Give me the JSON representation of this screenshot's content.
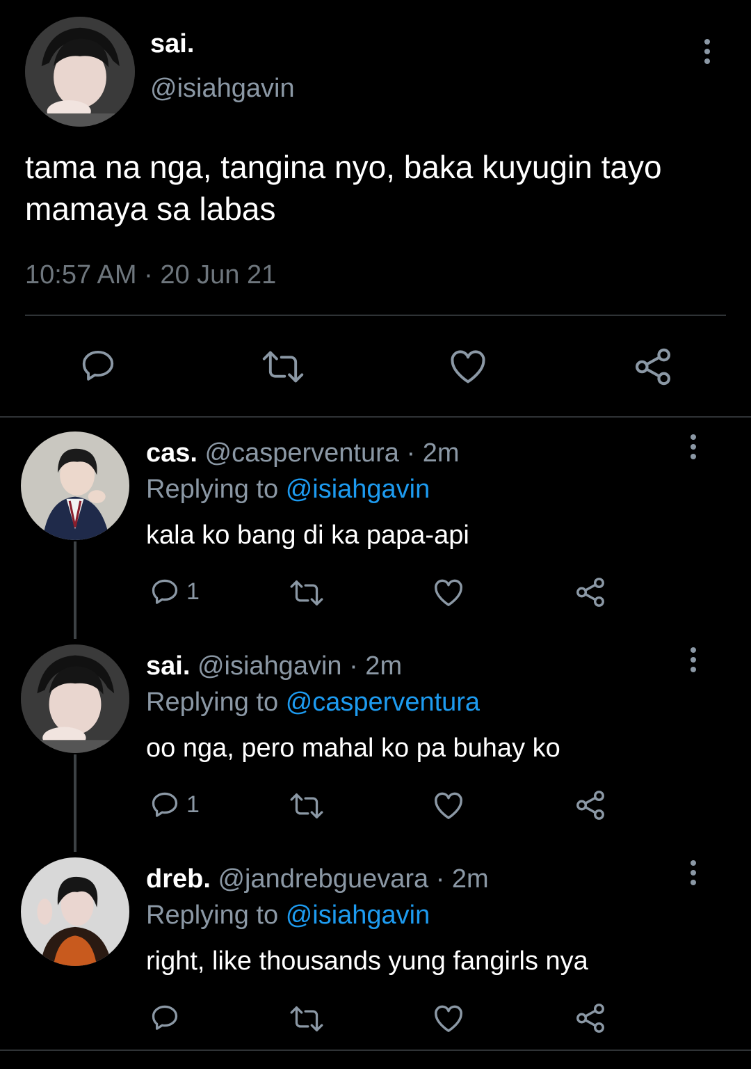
{
  "main_tweet": {
    "display_name": "sai.",
    "handle": "@isiahgavin",
    "text": "tama na nga, tangina nyo, baka kuyugin tayo mamaya sa labas",
    "timestamp": "10:57 AM · 20 Jun 21",
    "actions": [
      "reply-icon",
      "retweet-icon",
      "like-icon",
      "share-icon"
    ]
  },
  "replies": [
    {
      "display_name": "cas.",
      "handle": "@casperventura",
      "time": "· 2m",
      "replying_label": "Replying to",
      "replying_to": "@isiahgavin",
      "text": "kala ko bang di ka papa-api",
      "reply_count": "1"
    },
    {
      "display_name": "sai.",
      "handle": "@isiahgavin",
      "time": "· 2m",
      "replying_label": "Replying to",
      "replying_to": "@casperventura",
      "text": "oo nga, pero mahal ko pa buhay ko",
      "reply_count": "1"
    },
    {
      "display_name": "dreb.",
      "handle": "@jandrebguevara",
      "time": "· 2m",
      "replying_label": "Replying to",
      "replying_to": "@isiahgavin",
      "text": "right, like thousands yung fangirls nya",
      "reply_count": ""
    }
  ],
  "colors": {
    "background": "#000000",
    "text_primary": "#ffffff",
    "text_secondary": "#8b98a5",
    "link": "#1d9bf0",
    "divider": "#2f3336"
  }
}
